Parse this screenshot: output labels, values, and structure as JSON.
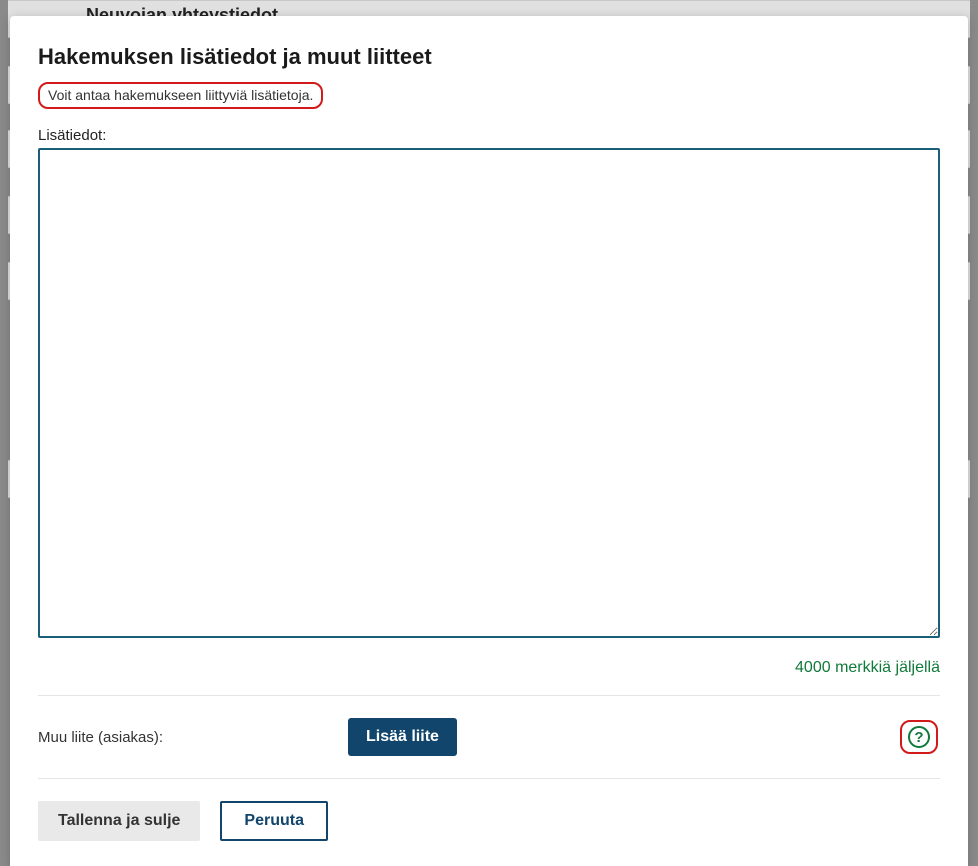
{
  "background": {
    "header_text": "Neuvojan yhteystiedot"
  },
  "modal": {
    "title": "Hakemuksen lisätiedot ja muut liitteet",
    "intro_text": "Voit antaa hakemukseen liittyviä lisätietoja.",
    "lisatiedot_label": "Lisätiedot:",
    "lisatiedot_value": "",
    "char_counter_text": "4000 merkkiä jäljellä",
    "attachment_label": "Muu liite (asiakas):",
    "add_attachment_label": "Lisää liite",
    "help_icon_char": "?",
    "save_close_label": "Tallenna ja sulje",
    "cancel_label": "Peruuta"
  }
}
